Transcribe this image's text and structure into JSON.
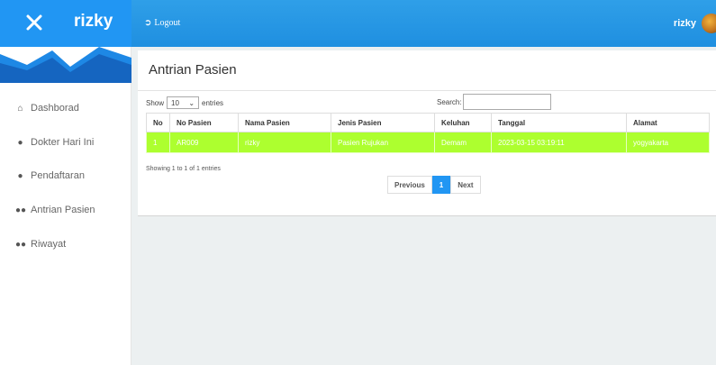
{
  "header": {
    "brand": "rizky",
    "logout_label": "Logout",
    "user_name": "rizky"
  },
  "sidebar": {
    "items": [
      {
        "label": "Dashborad",
        "icon": "home-icon"
      },
      {
        "label": "Dokter Hari Ini",
        "icon": "user-icon"
      },
      {
        "label": "Pendaftaran",
        "icon": "user-icon"
      },
      {
        "label": "Antrian Pasien",
        "icon": "users-icon"
      },
      {
        "label": "Riwayat",
        "icon": "users-icon"
      }
    ]
  },
  "main": {
    "title": "Antrian Pasien",
    "show_label": "Show",
    "entries_value": "10",
    "entries_label": "entries",
    "search_label": "Search:",
    "table": {
      "headers": [
        "No",
        "No Pasien",
        "Nama Pasien",
        "Jenis Pasien",
        "Keluhan",
        "Tanggal",
        "Alamat"
      ],
      "rows": [
        [
          "1",
          "AR009",
          "rizky",
          "Pasien Rujukan",
          "Demam",
          "2023-03-15 03:19:11",
          "yogyakarta"
        ]
      ]
    },
    "info": "Showing 1 to 1 of 1 entries",
    "pagination": {
      "previous": "Previous",
      "current": "1",
      "next": "Next"
    }
  },
  "colors": {
    "header": "#1f8fe0",
    "highlight_row": "#adff2f",
    "active_page": "#2196f3"
  }
}
